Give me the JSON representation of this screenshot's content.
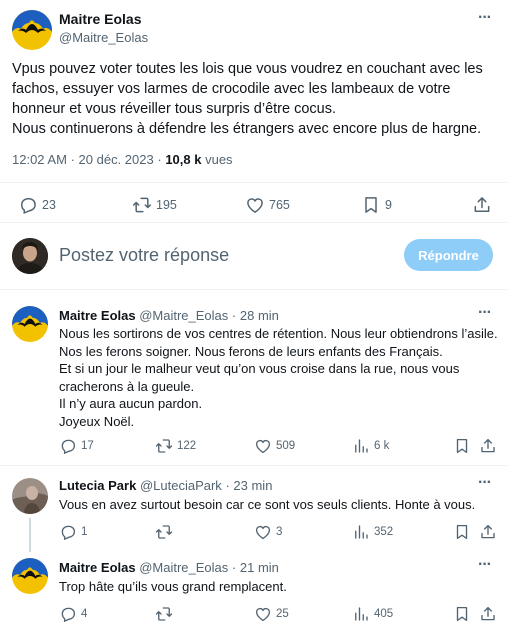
{
  "main_tweet": {
    "author_name": "Maitre Eolas",
    "author_handle": "@Maitre_Eolas",
    "text": "Vpus pouvez voter toutes les lois que vous voudrez en couchant avec les fachos, essuyer vos larmes de crocodile avec les lambeaux de votre honneur et vous réveiller tous surpris d’être cocus.\nNous continuerons à défendre les étrangers avec encore plus de hargne.",
    "time": "12:02 AM",
    "date": "20 déc. 2023",
    "views_count": "10,8 k",
    "views_label": "vues",
    "replies": "23",
    "reposts": "195",
    "likes": "765",
    "bookmarks": "9",
    "more_label": "···"
  },
  "composer": {
    "placeholder": "Postez votre réponse",
    "reply_button": "Répondre"
  },
  "replies": [
    {
      "author_name": "Maitre Eolas",
      "author_handle": "@Maitre_Eolas",
      "time_ago": "28 min",
      "text": "Nous les sortirons de vos centres de rétention. Nous leur obtiendrons l’asile. Nos les ferons soigner. Nous ferons de leurs enfants des Français.\nEt si un jour le malheur veut qu’on vous croise dans la rue, nous vous cracherons à la gueule.\nIl n’y aura aucun pardon.\nJoyeux Noël.",
      "replies": "17",
      "reposts": "122",
      "likes": "509",
      "views": "6 k"
    },
    {
      "author_name": "Lutecia Park",
      "author_handle": "@LuteciaPark",
      "time_ago": "23 min",
      "text": "Vous en avez surtout besoin car ce sont vos seuls clients. Honte à vous.",
      "replies": "1",
      "reposts": "",
      "likes": "3",
      "views": "352"
    },
    {
      "author_name": "Maitre Eolas",
      "author_handle": "@Maitre_Eolas",
      "time_ago": "21 min",
      "text": "Trop hâte qu’ils vous grand remplacent.",
      "replies": "4",
      "reposts": "",
      "likes": "25",
      "views": "405"
    }
  ],
  "separator": "·",
  "colors": {
    "accent": "#1d9bf0",
    "reply_button_disabled": "#8ecdf8",
    "avatar_blue": "#1d5fc0",
    "avatar_yellow": "#f2c200",
    "text_secondary": "#536471"
  },
  "icons": [
    "more-icon",
    "reply-icon",
    "repost-icon",
    "like-icon",
    "views-icon",
    "bookmark-icon",
    "share-icon"
  ]
}
